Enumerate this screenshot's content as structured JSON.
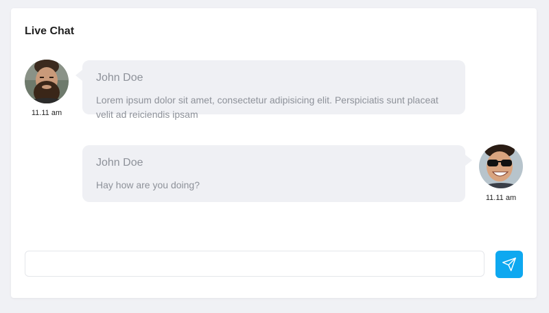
{
  "header": {
    "title": "Live Chat"
  },
  "messages": [
    {
      "side": "left",
      "avatar": "bearded-man-avatar",
      "author": "John Doe",
      "time": "11.11 am",
      "text": "Lorem ipsum dolor sit amet, consectetur adipisicing elit. Perspiciatis sunt placeat velit ad reiciendis ipsam"
    },
    {
      "side": "right",
      "avatar": "sunglasses-man-avatar",
      "author": "John Doe",
      "time": "11.11 am",
      "text": "Hay how are you doing?"
    }
  ],
  "composer": {
    "value": "",
    "placeholder": "",
    "send_icon": "paper-plane-icon"
  },
  "colors": {
    "page_background": "#f0f1f5",
    "card_background": "#ffffff",
    "bubble_background": "#eff0f4",
    "bubble_text": "#8d9199",
    "send_button": "#0ea8f0"
  }
}
